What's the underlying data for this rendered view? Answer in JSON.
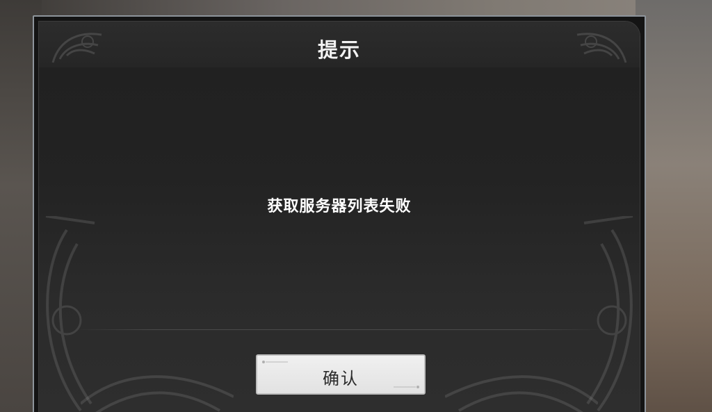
{
  "dialog": {
    "title": "提示",
    "message": "获取服务器列表失败",
    "confirm_label": "确认"
  },
  "colors": {
    "dialog_border": "#8e959c",
    "dialog_background": "#232323",
    "title_text": "#f2f2f2",
    "message_text": "#ffffff",
    "button_background": "#e8e8e8",
    "button_text": "#2a2a2a"
  },
  "icons": {
    "corner_ornament": "ornament-icon"
  }
}
